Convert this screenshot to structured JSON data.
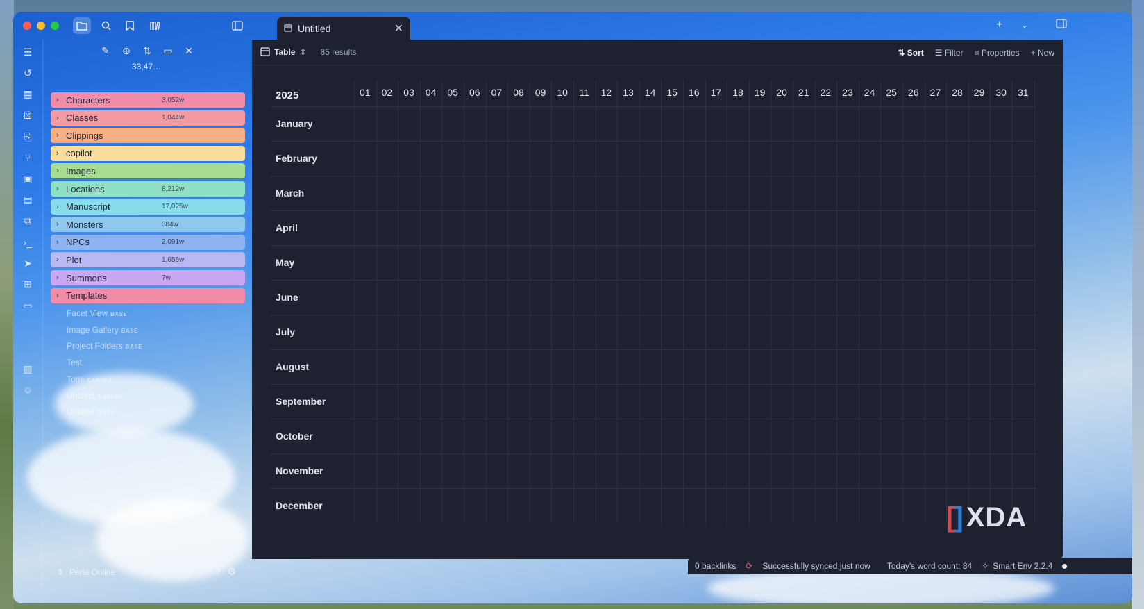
{
  "tab": {
    "title": "Untitled"
  },
  "sidebar": {
    "total_words": "33,47…",
    "folders": [
      {
        "name": "Characters",
        "count": "3,052w",
        "color": "#f28ba8"
      },
      {
        "name": "Classes",
        "count": "1,044w",
        "color": "#f49aa2"
      },
      {
        "name": "Clippings",
        "count": "",
        "color": "#f8ae84"
      },
      {
        "name": "copilot",
        "count": "",
        "color": "#f7dc9a"
      },
      {
        "name": "Images",
        "count": "",
        "color": "#a6dd8e"
      },
      {
        "name": "Locations",
        "count": "8,212w",
        "color": "#8fe0c4"
      },
      {
        "name": "Manuscript",
        "count": "17,025w",
        "color": "#88dcec"
      },
      {
        "name": "Monsters",
        "count": "384w",
        "color": "#8ec8ee"
      },
      {
        "name": "NPCs",
        "count": "2,091w",
        "color": "#8eb3f2"
      },
      {
        "name": "Plot",
        "count": "1,656w",
        "color": "#b8b8f4"
      },
      {
        "name": "Summons",
        "count": "7w",
        "color": "#c9a7f2"
      },
      {
        "name": "Templates",
        "count": "",
        "color": "#f28ba8"
      }
    ],
    "files": [
      {
        "name": "Facet View",
        "tag": "BASE"
      },
      {
        "name": "Image Gallery",
        "tag": "BASE"
      },
      {
        "name": "Project Folders",
        "tag": "BASE"
      },
      {
        "name": "Test",
        "tag": ""
      },
      {
        "name": "Toris",
        "tag": "CANVAS"
      },
      {
        "name": "Untitled",
        "tag": "CANVAS"
      },
      {
        "name": "Untitled",
        "tag": "BASE"
      }
    ],
    "vault_name": "Perla Online"
  },
  "toolbar": {
    "view": "Table",
    "results": "85 results",
    "sort": "Sort",
    "filter": "Filter",
    "properties": "Properties",
    "new": "New"
  },
  "table": {
    "year": "2025",
    "days": [
      "01",
      "02",
      "03",
      "04",
      "05",
      "06",
      "07",
      "08",
      "09",
      "10",
      "11",
      "12",
      "13",
      "14",
      "15",
      "16",
      "17",
      "18",
      "19",
      "20",
      "21",
      "22",
      "23",
      "24",
      "25",
      "26",
      "27",
      "28",
      "29",
      "30",
      "31"
    ],
    "months": [
      "January",
      "February",
      "March",
      "April",
      "May",
      "June",
      "July",
      "August",
      "September",
      "October",
      "November",
      "December"
    ]
  },
  "watermark": {
    "text": "XDA"
  },
  "status": {
    "backlinks": "0 backlinks",
    "sync": "Successfully synced just now",
    "word_count": "Today's word count: 84",
    "smart_env": "Smart Env 2.2.4"
  }
}
